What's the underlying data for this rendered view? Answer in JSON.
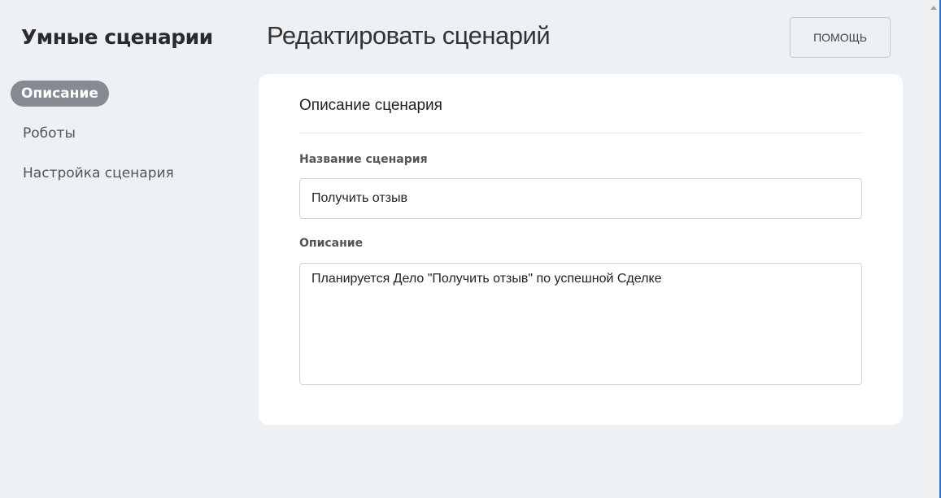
{
  "sidebar": {
    "brand": "Умные сценарии",
    "items": [
      {
        "label": "Описание",
        "active": true
      },
      {
        "label": "Роботы"
      },
      {
        "label": "Настройка сценария"
      }
    ]
  },
  "header": {
    "title": "Редактировать сценарий",
    "help_label": "ПОМОЩЬ"
  },
  "card": {
    "title": "Описание сценария",
    "name_label": "Название сценария",
    "name_value": "Получить отзыв",
    "description_label": "Описание",
    "description_value": "Планируется Дело \"Получить отзыв\" по успешной Сделке"
  }
}
